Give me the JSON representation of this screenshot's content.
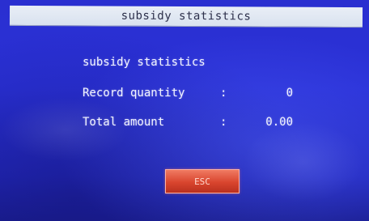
{
  "title_bar": {
    "title": "subsidy statistics"
  },
  "main": {
    "heading": "subsidy statistics",
    "rows": [
      {
        "label": "Record quantity",
        "separator": ":",
        "value": "0"
      },
      {
        "label": "Total amount",
        "separator": ":",
        "value": "0.00"
      }
    ]
  },
  "buttons": {
    "esc_label": "ESC"
  },
  "colors": {
    "screen_bg": "#2a31d8",
    "title_bar_bg": "#e9eef6",
    "text": "#f2f4ff",
    "button_bg": "#d9452e"
  }
}
